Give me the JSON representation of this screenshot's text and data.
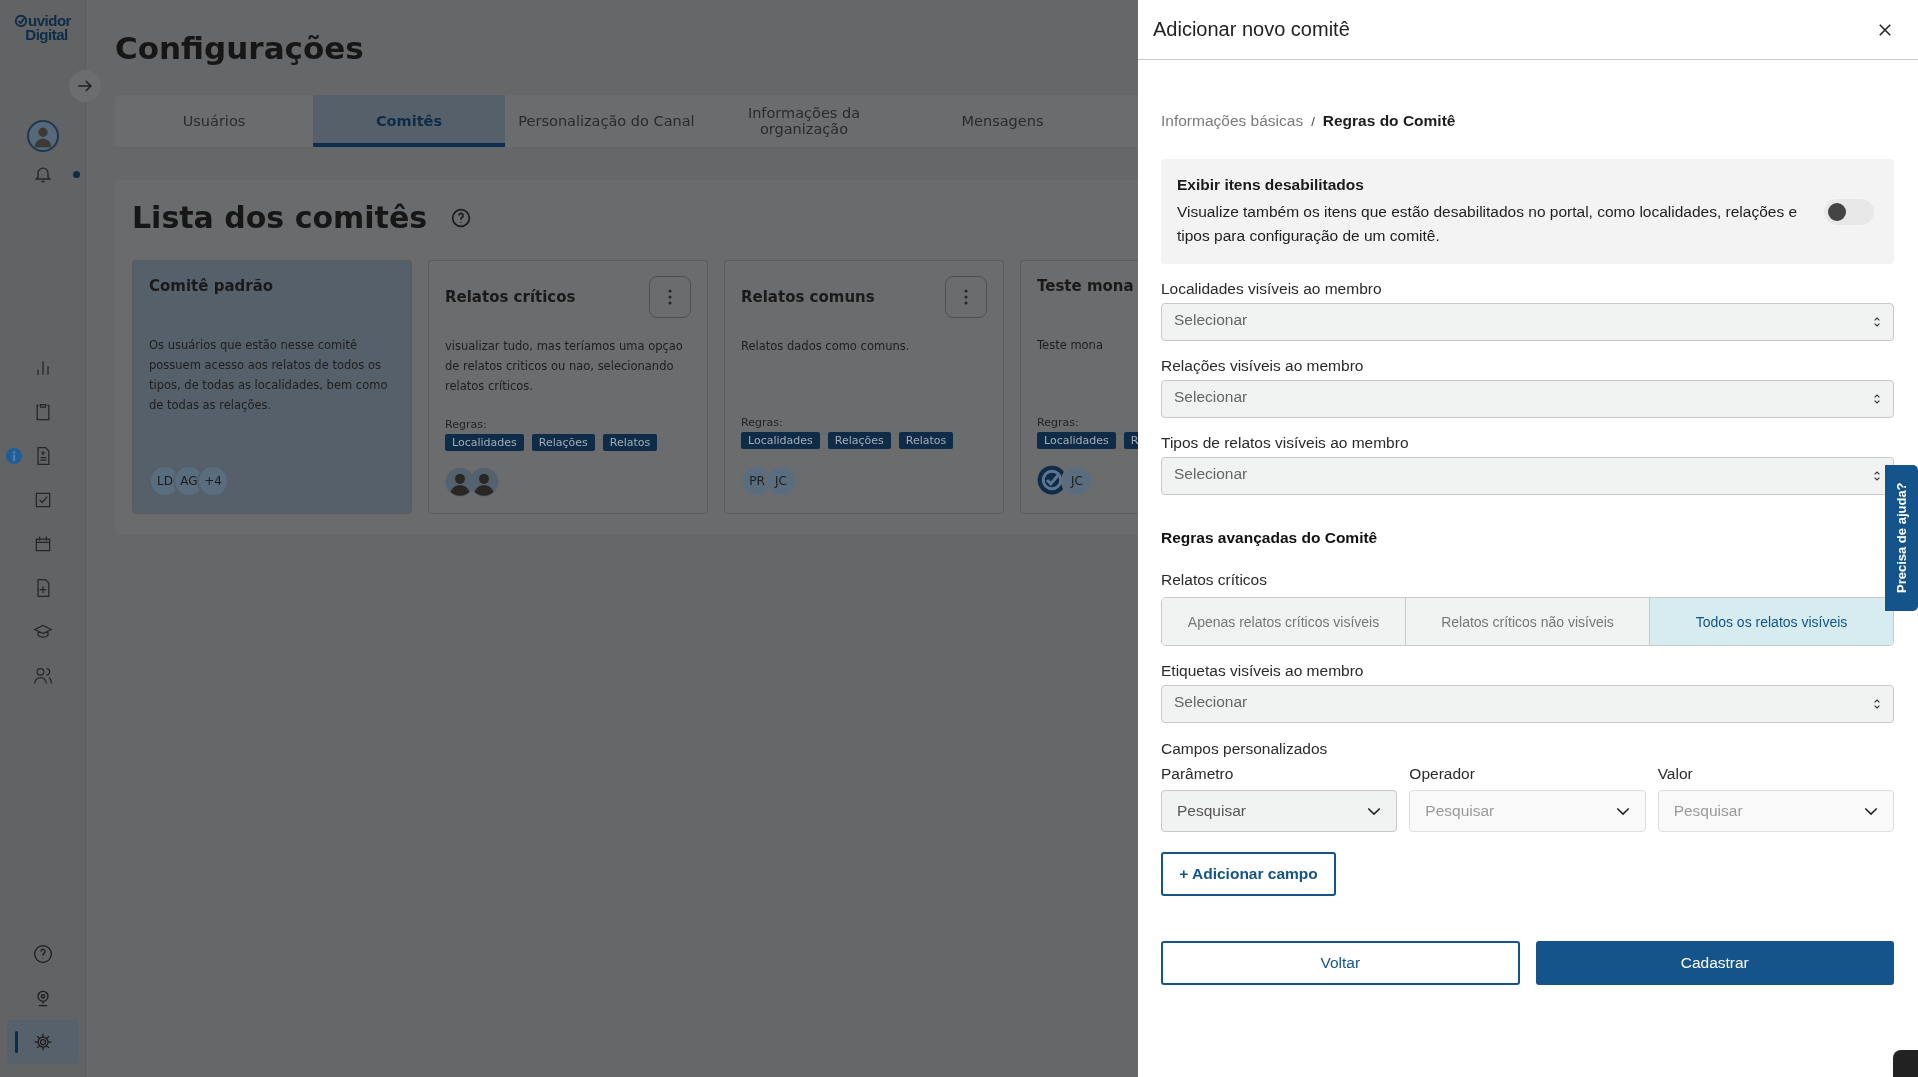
{
  "sidebar": {
    "logo_lines": [
      "uvidor",
      "Digital"
    ],
    "top": [
      {
        "kind": "bell",
        "unread": true
      }
    ],
    "nav": [
      {
        "kind": "chart",
        "selected": false,
        "info_badge": false
      },
      {
        "kind": "clipboard",
        "selected": false,
        "info_badge": false
      },
      {
        "kind": "document",
        "selected": false,
        "info_badge": true
      },
      {
        "kind": "checkbox",
        "selected": false,
        "info_badge": false
      },
      {
        "kind": "calendar",
        "selected": false,
        "info_badge": false
      },
      {
        "kind": "file-plus",
        "selected": false,
        "info_badge": false
      },
      {
        "kind": "graduation",
        "selected": false,
        "info_badge": false
      },
      {
        "kind": "people",
        "selected": false,
        "info_badge": false
      }
    ],
    "bottom": [
      {
        "kind": "help",
        "selected": false,
        "info_badge": false
      },
      {
        "kind": "webcam",
        "selected": false,
        "info_badge": false
      },
      {
        "kind": "settings",
        "selected": true,
        "info_badge": false
      }
    ]
  },
  "page_title": "Configurações",
  "tabs": [
    {
      "label": "Usuários",
      "selected": false
    },
    {
      "label": "Comitês",
      "selected": true
    },
    {
      "label": "Personalização do Canal",
      "selected": false
    },
    {
      "label": "Informações da organização",
      "selected": false
    },
    {
      "label": "Mensagens",
      "selected": false
    }
  ],
  "section_title": "Lista dos comitês",
  "cards": [
    {
      "title": "Comitê padrão",
      "selected": true,
      "menu": false,
      "description": "Os usuários que estão nesse comitê possuem acesso aos relatos de todos os tipos, de todas as localidades, bem como de todas as relações.",
      "members": [
        {
          "kind": "initials",
          "text": "LD"
        },
        {
          "kind": "initials",
          "text": "AG"
        },
        {
          "kind": "initials",
          "text": "+4"
        }
      ]
    },
    {
      "title": "Relatos críticos",
      "selected": false,
      "menu": true,
      "description": "visualizar tudo, mas teríamos uma opçao de relatos criticos ou nao, selecionando relatos críticos.",
      "rules_label": "Regras:",
      "rules": [
        "Localidades",
        "Relações",
        "Relatos"
      ],
      "members": [
        {
          "kind": "photo"
        },
        {
          "kind": "photo"
        }
      ]
    },
    {
      "title": "Relatos comuns",
      "selected": false,
      "menu": true,
      "description": "Relatos dados como comuns.",
      "rules_label": "Regras:",
      "rules": [
        "Localidades",
        "Relações",
        "Relatos"
      ],
      "members": [
        {
          "kind": "initials",
          "text": "PR"
        },
        {
          "kind": "initials",
          "text": "JC"
        }
      ]
    },
    {
      "title": "Teste mona",
      "selected": false,
      "menu": false,
      "description": "Teste mona",
      "rules_label": "Regras:",
      "rules": [
        "Localidades",
        "R"
      ],
      "members": [
        {
          "kind": "logo"
        },
        {
          "kind": "initials",
          "text": "JC"
        }
      ]
    }
  ],
  "drawer": {
    "title": "Adicionar novo comitê",
    "breadcrumb_separator": "/",
    "breadcrumb": [
      {
        "label": "Informações básicas",
        "selected": false
      },
      {
        "label": "Regras do Comitê",
        "selected": true
      }
    ],
    "disabled_items": {
      "title": "Exibir itens desabilitados",
      "text": "Visualize também os itens que estão desabilitados no portal, como localidades, relações e tipos para configuração de um comitê.",
      "on": false
    },
    "selects": [
      {
        "label": "Localidades visíveis ao membro",
        "placeholder": "Selecionar"
      },
      {
        "label": "Relações visíveis ao membro",
        "placeholder": "Selecionar"
      },
      {
        "label": "Tipos de relatos visíveis ao membro",
        "placeholder": "Selecionar"
      }
    ],
    "advanced_title": "Regras avançadas do Comitê",
    "critical": {
      "label": "Relatos críticos",
      "options": [
        {
          "label": "Apenas relatos críticos visíveis",
          "selected": false
        },
        {
          "label": "Relatos críticos não visíveis",
          "selected": false
        },
        {
          "label": "Todos os relatos visíveis",
          "selected": true
        }
      ]
    },
    "tags_select": {
      "label": "Etiquetas visíveis ao membro",
      "placeholder": "Selecionar"
    },
    "custom_fields": {
      "label": "Campos personalizados",
      "columns": [
        {
          "label": "Parâmetro",
          "placeholder": "Pesquisar",
          "disabled": false
        },
        {
          "label": "Operador",
          "placeholder": "Pesquisar",
          "disabled": true
        },
        {
          "label": "Valor",
          "placeholder": "Pesquisar",
          "disabled": true
        }
      ],
      "add_button": "+ Adicionar campo"
    },
    "buttons": [
      {
        "label": "Voltar",
        "kind": "secondary"
      },
      {
        "label": "Cadastrar",
        "kind": "primary"
      }
    ],
    "help_tab": "Precisa de ajuda?"
  }
}
